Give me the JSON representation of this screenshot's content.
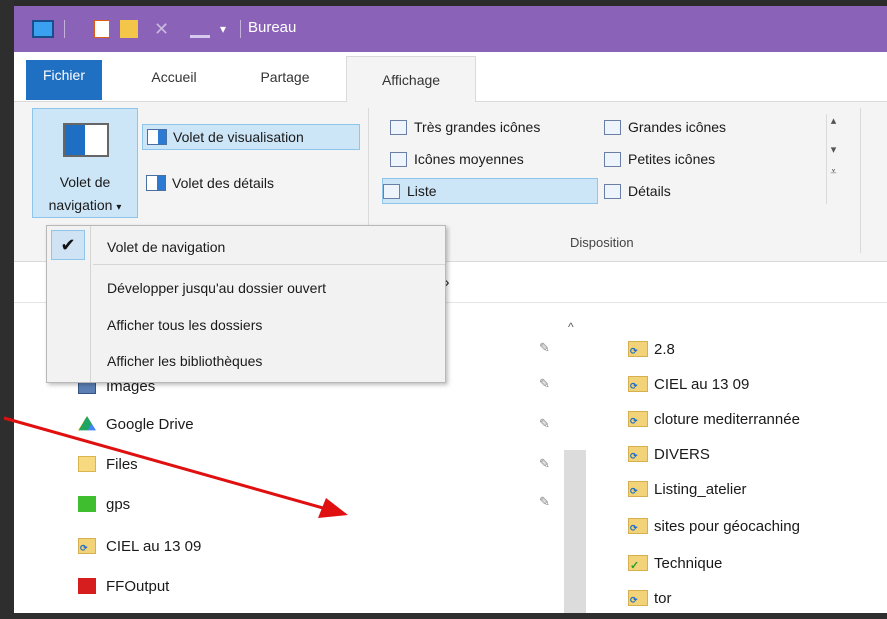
{
  "window": {
    "title": "Bureau"
  },
  "tabs": [
    {
      "label": "Fichier"
    },
    {
      "label": "Accueil"
    },
    {
      "label": "Partage"
    },
    {
      "label": "Affichage"
    }
  ],
  "ribbon": {
    "nav_button": {
      "line1": "Volet de",
      "line2": "navigation"
    },
    "preview_pane": "Volet de visualisation",
    "details_pane": "Volet des détails",
    "layout": {
      "items": [
        {
          "label": "Très grandes icônes"
        },
        {
          "label": "Grandes icônes"
        },
        {
          "label": "Icônes moyennes"
        },
        {
          "label": "Petites icônes"
        },
        {
          "label": "Liste"
        },
        {
          "label": "Détails"
        }
      ],
      "group_label": "Disposition"
    }
  },
  "menu": {
    "items": [
      {
        "label": "Volet de navigation",
        "checked": true
      },
      {
        "label": "Développer jusqu'au dossier ouvert"
      },
      {
        "label": "Afficher tous les dossiers"
      },
      {
        "label": "Afficher les bibliothèques"
      }
    ]
  },
  "address": {
    "text": "u  ›"
  },
  "nav_items": [
    {
      "label": "Images"
    },
    {
      "label": "Google Drive"
    },
    {
      "label": "Files"
    },
    {
      "label": "gps"
    },
    {
      "label": "CIEL au 13 09"
    },
    {
      "label": "FFOutput"
    }
  ],
  "files": [
    {
      "label": "2.8"
    },
    {
      "label": "CIEL au 13 09"
    },
    {
      "label": "cloture mediterrannée"
    },
    {
      "label": "DIVERS"
    },
    {
      "label": "Listing_atelier"
    },
    {
      "label": "sites pour géocaching"
    },
    {
      "label": "Technique"
    },
    {
      "label": "tor"
    }
  ],
  "colors": {
    "titlebar": "#8a63b8",
    "file_tab": "#1f6fc2",
    "selection": "#cde6f7",
    "annotation_arrow": "#e01010"
  }
}
